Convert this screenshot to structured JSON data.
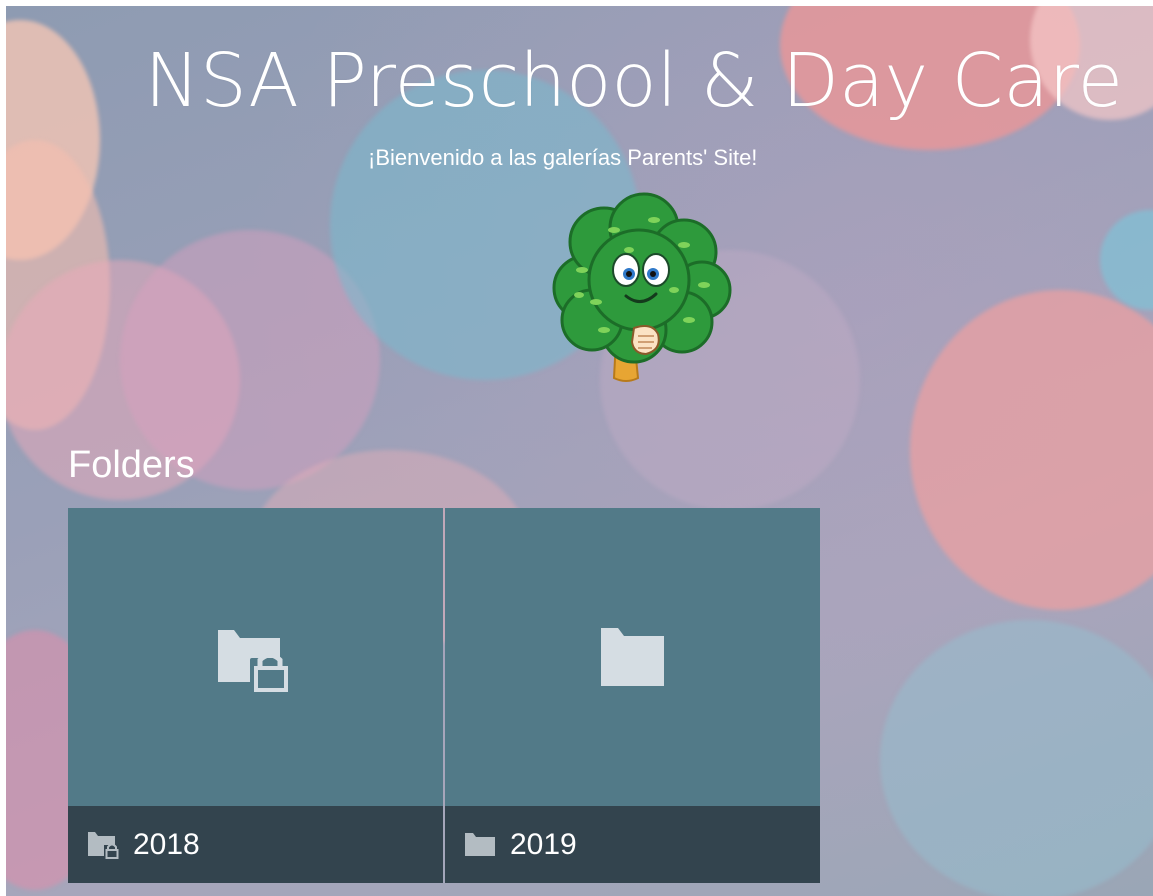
{
  "header": {
    "title": "NSA Preschool & Day Care",
    "subtitle": "¡Bienvenido a las galerías Parents' Site!",
    "mascot_icon": "tree-mascot-icon"
  },
  "folders": {
    "heading": "Folders",
    "items": [
      {
        "name": "2018",
        "icon": "locked-folder-icon",
        "locked": true
      },
      {
        "name": "2019",
        "icon": "folder-icon",
        "locked": false
      }
    ]
  },
  "colors": {
    "tile": "#527a88",
    "tile_bar": "#33444e",
    "folder_icon": "#d5dde3",
    "text": "#ffffff"
  }
}
